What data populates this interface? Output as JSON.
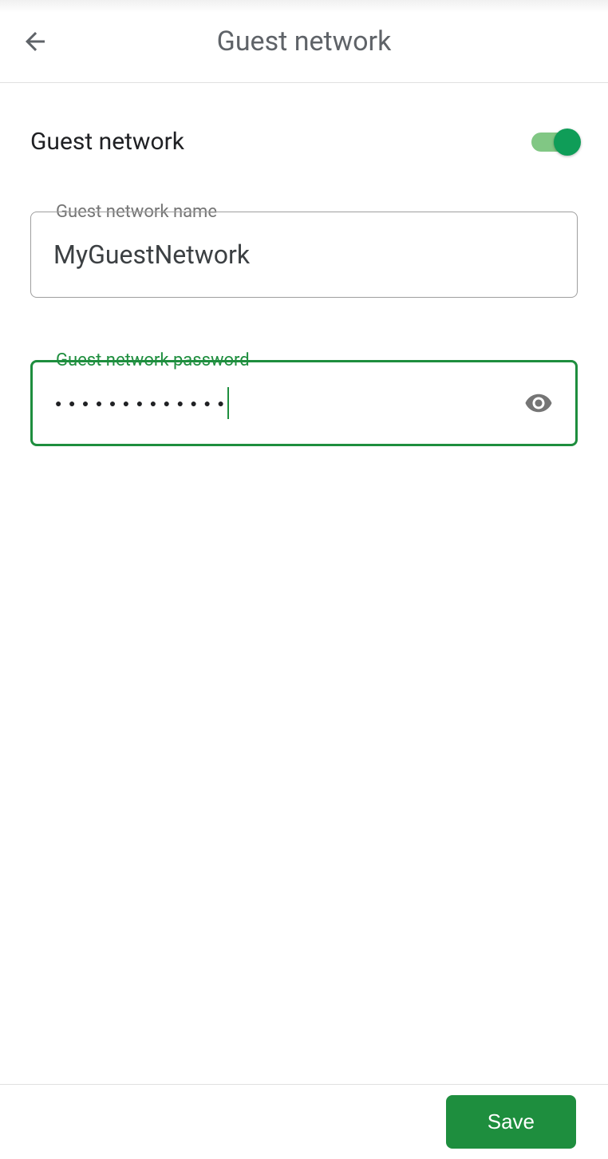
{
  "header": {
    "title": "Guest network"
  },
  "toggle": {
    "label": "Guest network",
    "enabled": true
  },
  "name_field": {
    "label": "Guest network name",
    "value": "MyGuestNetwork"
  },
  "password_field": {
    "label": "Guest network password",
    "masked_value": "●●●●●●●●●●●●●",
    "focused": true
  },
  "footer": {
    "save_label": "Save"
  }
}
